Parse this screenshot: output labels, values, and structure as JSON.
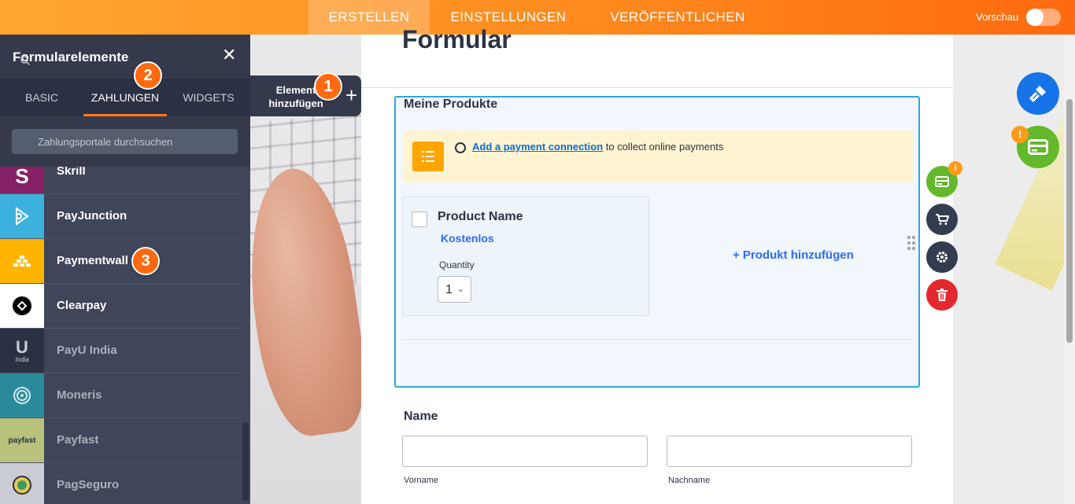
{
  "topbar": {
    "tabs": [
      {
        "label": "ERSTELLEN",
        "active": true
      },
      {
        "label": "EINSTELLUNGEN",
        "active": false
      },
      {
        "label": "VERÖFFENTLICHEN",
        "active": false
      }
    ],
    "preview_label": "Vorschau",
    "preview_on": false
  },
  "sidebar": {
    "title": "Formularelemente",
    "close_icon": "close-icon",
    "tabs": [
      {
        "label": "BASIC",
        "active": false
      },
      {
        "label": "ZAHLUNGEN",
        "active": true
      },
      {
        "label": "WIDGETS",
        "active": false
      }
    ],
    "search_placeholder": "Zahlungsportale durchsuchen",
    "items": [
      {
        "label": "Skrill",
        "icon": "skrill-logo",
        "color": "#862165",
        "dim": false
      },
      {
        "label": "PayJunction",
        "icon": "payjunction-logo",
        "color": "#3db1dd",
        "dim": false
      },
      {
        "label": "Paymentwall",
        "icon": "paymentwall-logo",
        "color": "#ffb500",
        "dim": false
      },
      {
        "label": "Clearpay",
        "icon": "clearpay-logo",
        "color": "#ffffff",
        "dim": false
      },
      {
        "label": "PayU India",
        "icon": "payu-india-logo",
        "icon_text": "India",
        "color": "#2b3144",
        "dim": true
      },
      {
        "label": "Moneris",
        "icon": "moneris-logo",
        "color": "#2a8a9a",
        "dim": true
      },
      {
        "label": "Payfast",
        "icon": "payfast-logo",
        "icon_text": "payfast",
        "color": "#b8c27a",
        "dim": true
      },
      {
        "label": "PagSeguro",
        "icon": "pagseguro-logo",
        "color": "#c9ccd3",
        "dim": true
      }
    ]
  },
  "add_element": {
    "label": "Element hinzufügen",
    "plus": "+"
  },
  "callouts": [
    "1",
    "2",
    "3"
  ],
  "form": {
    "title": "Formular",
    "product_section": {
      "heading": "Meine Produkte",
      "notice_link": "Add a payment connection",
      "notice_text": " to collect online payments",
      "product_name": "Product Name",
      "product_price": "Kostenlos",
      "quantity_label": "Quantity",
      "quantity_value": "1",
      "add_product": "+ Produkt hinzufügen"
    },
    "name_field": {
      "label": "Name",
      "first_sublabel": "Vorname",
      "last_sublabel": "Nachname"
    }
  },
  "actions": {
    "warning_badge": "!",
    "buttons": [
      "payment-settings-icon",
      "cart-icon",
      "gear-icon",
      "trash-icon"
    ]
  },
  "colors": {
    "accent": "#ff7a1a",
    "selected_border": "#2fa6e0",
    "link": "#0b6bd6",
    "product_blue": "#2e69ff"
  }
}
